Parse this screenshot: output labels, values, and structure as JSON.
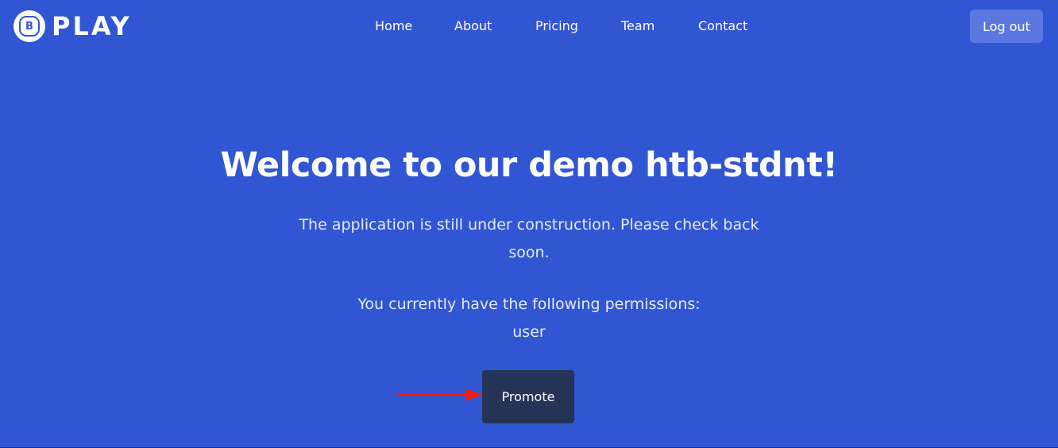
{
  "header": {
    "logo_letter": "B",
    "logo_text": "PLAY",
    "nav": {
      "home": "Home",
      "about": "About",
      "pricing": "Pricing",
      "team": "Team",
      "contact": "Contact"
    },
    "logout_label": "Log out"
  },
  "hero": {
    "title": "Welcome to our demo htb-stdnt!",
    "description": "The application is still under construction. Please check back soon.",
    "permissions_label": "You currently have the following permissions:",
    "permissions_value": "user",
    "promote_label": "Promote"
  },
  "annotation": {
    "arrow_icon": "arrow-right-icon",
    "arrow_color": "#e8201a"
  },
  "colors": {
    "background": "#3056d3",
    "logout_button": "#5a78e0",
    "promote_button": "#243356"
  }
}
